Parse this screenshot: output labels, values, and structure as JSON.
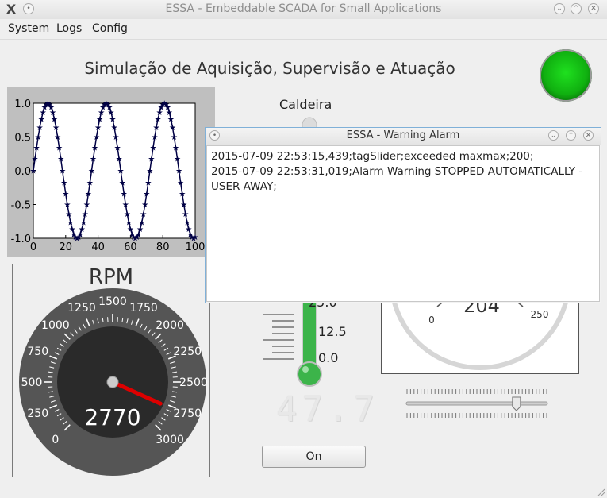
{
  "window": {
    "title": "ESSA - Embeddable SCADA for Small Applications",
    "app_icon_glyph": "X"
  },
  "menu": {
    "items": [
      "System",
      "Logs",
      "Config"
    ]
  },
  "main": {
    "heading": "Simulação de Aquisição, Supervisão e Atuação",
    "led_color": "#10b010",
    "thermometer_label": "Caldeira",
    "thermometer_ticks": [
      "25.0",
      "12.5",
      "0.0"
    ],
    "lcd_value": "47.7",
    "on_button_label": "On"
  },
  "chart_data": {
    "type": "line",
    "marker": "star",
    "x_ticks": [
      "0",
      "20",
      "40",
      "60",
      "80",
      "100"
    ],
    "y_ticks": [
      "1.0",
      "0.5",
      "0.0",
      "-0.5",
      "-1.0"
    ],
    "xlim": [
      0,
      100
    ],
    "ylim": [
      -1.0,
      1.0
    ],
    "series": [
      {
        "function": "sin",
        "period": 36,
        "phase_deg": 0,
        "samples": 100,
        "color": "#000044"
      }
    ]
  },
  "rpm_gauge": {
    "title": "RPM",
    "value": 2770,
    "value_label": "2770",
    "min": 0,
    "max": 3000,
    "tick_labels": [
      "0",
      "250",
      "500",
      "750",
      "1000",
      "1250",
      "1500",
      "1750",
      "2000",
      "2250",
      "2500",
      "2750",
      "3000"
    ],
    "needle_color": "#dd0000"
  },
  "right_gauge": {
    "value_label": "204",
    "tick_labels": [
      "0",
      "250"
    ]
  },
  "slider": {
    "value_fraction": 0.78
  },
  "alarm_dialog": {
    "title": "ESSA - Warning Alarm",
    "lines": [
      "2015-07-09 22:53:15,439;tagSlider;exceeded maxmax;200;",
      "2015-07-09 22:53:31,019;Alarm Warning STOPPED AUTOMATICALLY - USER AWAY;"
    ]
  },
  "icons": {
    "titlebar_buttons": [
      "minimize-icon",
      "maximize-icon",
      "close-icon"
    ]
  }
}
